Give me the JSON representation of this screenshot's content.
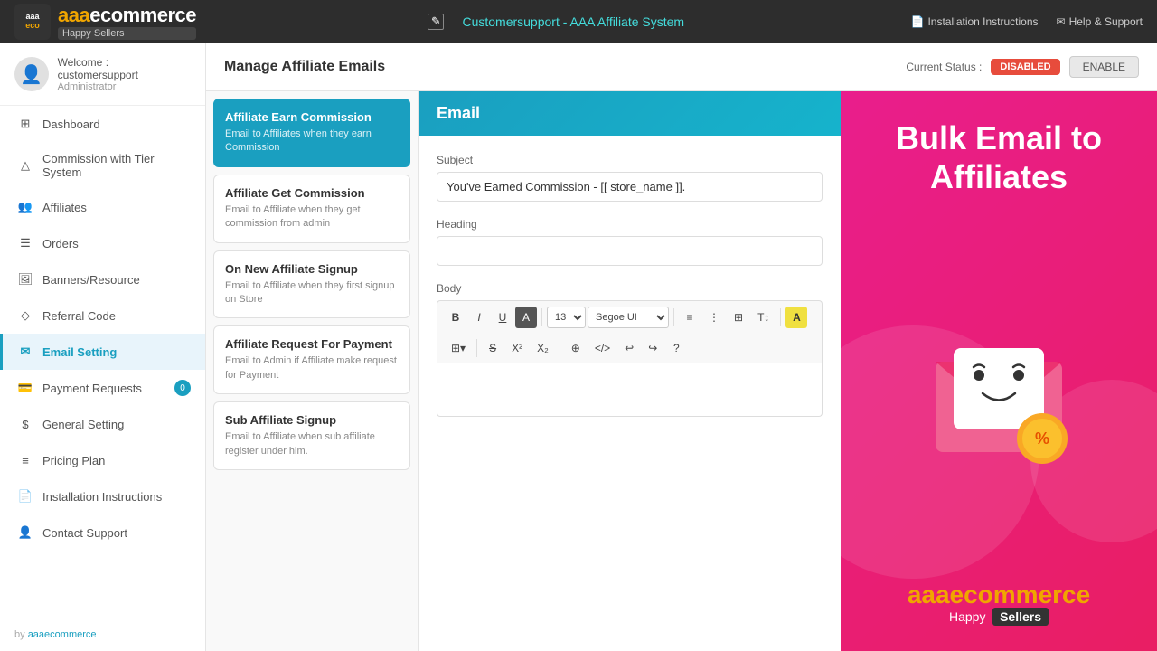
{
  "topbar": {
    "logo_main": "aaa",
    "logo_accent": "ecommerce",
    "logo_sub": "Happy Sellers",
    "title": "Customersupport - AAA Affiliate System",
    "nav": [
      {
        "label": "Installation Instructions",
        "icon": "file-icon"
      },
      {
        "label": "Help & Support",
        "icon": "mail-icon"
      }
    ]
  },
  "sidebar": {
    "user": {
      "welcome": "Welcome : customersupport",
      "role": "Administrator"
    },
    "items": [
      {
        "id": "dashboard",
        "label": "Dashboard",
        "icon": "grid-icon",
        "active": false
      },
      {
        "id": "commission-tier",
        "label": "Commission with Tier System",
        "icon": "triangle-icon",
        "active": false
      },
      {
        "id": "affiliates",
        "label": "Affiliates",
        "icon": "users-icon",
        "active": false
      },
      {
        "id": "orders",
        "label": "Orders",
        "icon": "list-icon",
        "active": false
      },
      {
        "id": "banners-resource",
        "label": "Banners/Resource",
        "icon": "image-icon",
        "active": false
      },
      {
        "id": "referral-code",
        "label": "Referral Code",
        "icon": "diamond-icon",
        "active": false
      },
      {
        "id": "email-setting",
        "label": "Email Setting",
        "icon": "envelope-icon",
        "active": true
      },
      {
        "id": "payment-requests",
        "label": "Payment Requests",
        "icon": "card-icon",
        "active": false,
        "badge": "0"
      },
      {
        "id": "general-setting",
        "label": "General Setting",
        "icon": "dollar-icon",
        "active": false
      },
      {
        "id": "pricing-plan",
        "label": "Pricing Plan",
        "icon": "sliders-icon",
        "active": false
      },
      {
        "id": "installation-instructions",
        "label": "Installation Instructions",
        "icon": "doc-icon",
        "active": false
      },
      {
        "id": "contact-support",
        "label": "Contact Support",
        "icon": "person-icon",
        "active": false
      }
    ],
    "footer_by": "by",
    "footer_link": "aaaecommerce"
  },
  "page": {
    "title": "Manage Affiliate Emails",
    "current_status_label": "Current Status :",
    "status": "DISABLED",
    "enable_btn": "ENABLE"
  },
  "email_list": [
    {
      "id": "earn-commission",
      "title": "Affiliate Earn Commission",
      "desc": "Email to Affiliates when they earn Commission",
      "active": true
    },
    {
      "id": "get-commission",
      "title": "Affiliate Get Commission",
      "desc": "Email to Affiliate when they get commission from admin",
      "active": false
    },
    {
      "id": "new-signup",
      "title": "On New Affiliate Signup",
      "desc": "Email to Affiliate when they first signup on Store",
      "active": false
    },
    {
      "id": "request-payment",
      "title": "Affiliate Request For Payment",
      "desc": "Email to Admin if Affiliate make request for Payment",
      "active": false
    },
    {
      "id": "sub-signup",
      "title": "Sub Affiliate Signup",
      "desc": "Email to Affiliate when sub affiliate register under him.",
      "active": false
    }
  ],
  "email_editor": {
    "header": "Email",
    "subject_label": "Subject",
    "subject_value": "You've Earned Commission - [[ store_name ]].",
    "heading_label": "Heading",
    "heading_value": "",
    "body_label": "Body",
    "toolbar": {
      "font_size": "13",
      "font_family": "Segoe UI",
      "bold": "B",
      "italic": "I",
      "underline": "U",
      "strike": "S"
    }
  },
  "promo": {
    "title": "Bulk Email to Affiliates",
    "logo_main": "aaa",
    "logo_accent": "ecommerce",
    "logo_sub": "Happy",
    "logo_sellers": "Sellers"
  }
}
